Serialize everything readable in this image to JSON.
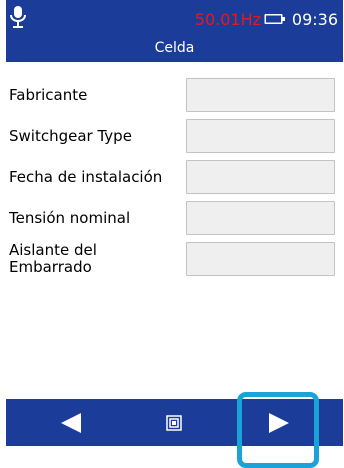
{
  "status_bar": {
    "frequency": "50.01Hz",
    "time": "09:36",
    "mic_icon": "microphone-icon",
    "battery_icon": "battery-icon"
  },
  "header": {
    "title": "Celda"
  },
  "form": {
    "fields": [
      {
        "label": "Fabricante",
        "value": ""
      },
      {
        "label": "Switchgear Type",
        "value": ""
      },
      {
        "label": "Fecha de instalación",
        "value": ""
      },
      {
        "label": "Tensión nominal",
        "value": ""
      },
      {
        "label": "Aislante del Embarrado",
        "value": ""
      }
    ]
  },
  "footer": {
    "back_icon": "back-arrow-icon",
    "home_icon": "home-icon",
    "next_icon": "next-arrow-icon"
  },
  "colors": {
    "header_bg": "#1c3c9a",
    "footer_bg": "#1c3c9a",
    "frequency": "#e11b1b",
    "highlight": "#1aa3d8"
  }
}
